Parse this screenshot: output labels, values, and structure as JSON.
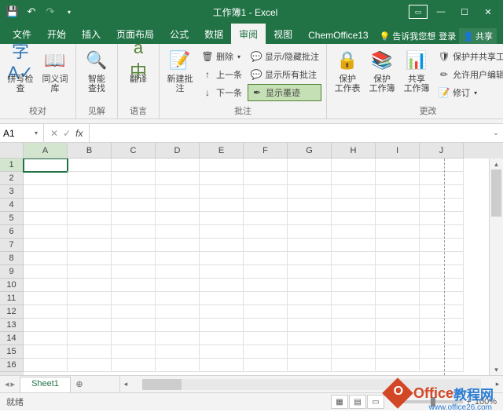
{
  "title": "工作簿1 - Excel",
  "tabs": {
    "file": "文件",
    "home": "开始",
    "insert": "插入",
    "layout": "页面布局",
    "formulas": "公式",
    "data": "数据",
    "review": "审阅",
    "view": "视图",
    "chemoffice": "ChemOffice13"
  },
  "tellme": "告诉我您想",
  "signin": "登录",
  "share": "共享",
  "ribbon": {
    "proofing": {
      "spelling": "拼写检查",
      "thesaurus": "同义词库",
      "label": "校对"
    },
    "insights": {
      "lookup": "智能\n查找",
      "label": "见解"
    },
    "language": {
      "translate": "翻译",
      "label": "语言"
    },
    "comments": {
      "new": "新建批注",
      "delete": "删除",
      "prev": "上一条",
      "next": "下一条",
      "showhide": "显示/隐藏批注",
      "showall": "显示所有批注",
      "showink": "显示墨迹",
      "label": "批注"
    },
    "changes": {
      "protect_sheet": "保护\n工作表",
      "protect_wb": "保护\n工作簿",
      "share_wb": "共享\n工作簿",
      "protect_share": "保护并共享工作簿",
      "allow_edit": "允许用户编辑区域",
      "track": "修订",
      "label": "更改"
    }
  },
  "namebox": "A1",
  "fx": "fx",
  "columns": [
    "A",
    "B",
    "C",
    "D",
    "E",
    "F",
    "G",
    "H",
    "I",
    "J"
  ],
  "rows": [
    "1",
    "2",
    "3",
    "4",
    "5",
    "6",
    "7",
    "8",
    "9",
    "10",
    "11",
    "12",
    "13",
    "14",
    "15",
    "16"
  ],
  "sheet_tab": "Sheet1",
  "status": "就绪",
  "zoom": "100%",
  "watermark": {
    "t1": "Office",
    "t2": "教程网",
    "url": "www.office26.com"
  }
}
